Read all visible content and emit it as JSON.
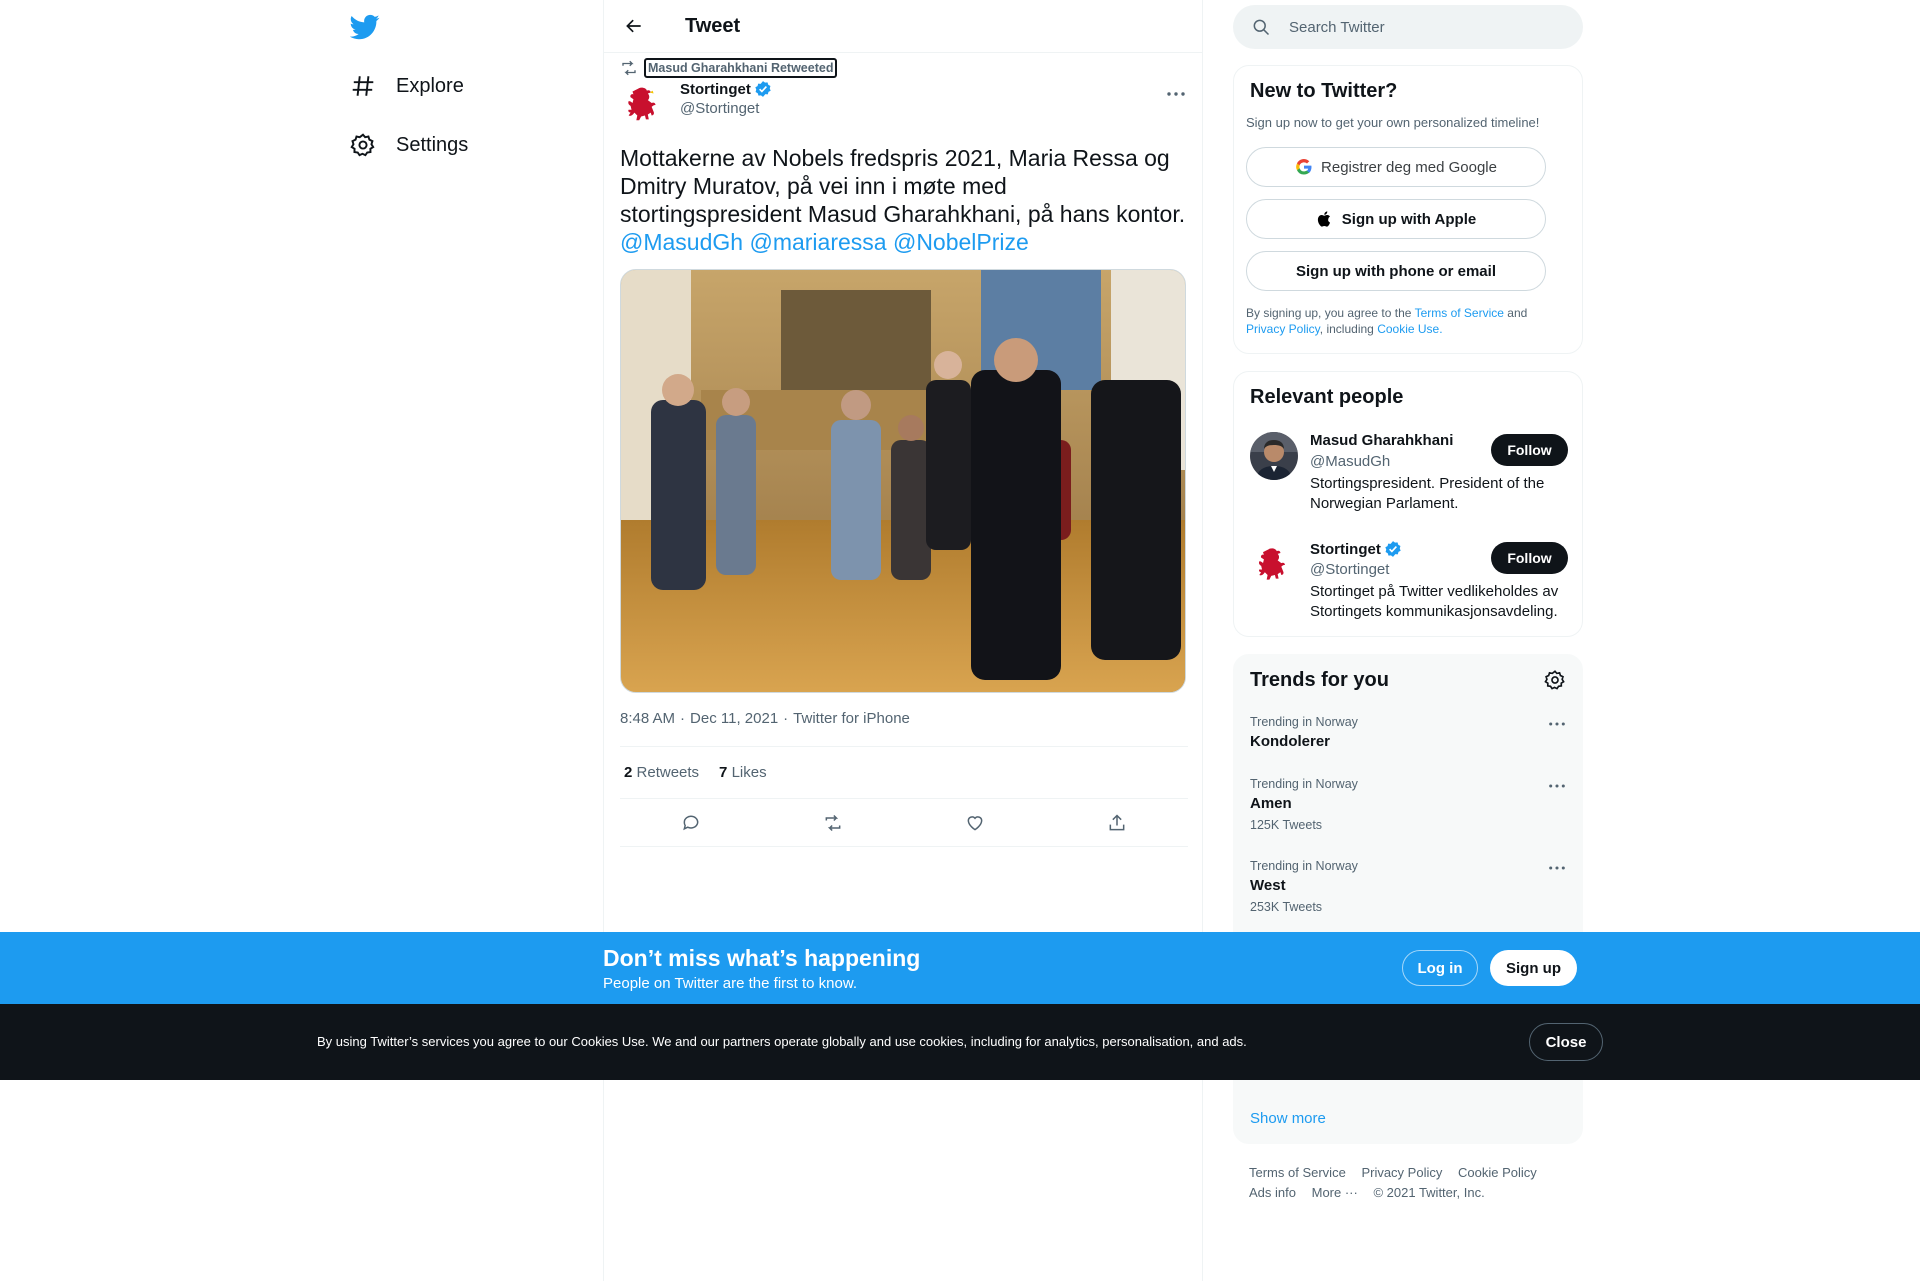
{
  "nav": {
    "items": [
      {
        "label": "Explore",
        "icon": "hashtag-icon"
      },
      {
        "label": "Settings",
        "icon": "gear-icon"
      }
    ]
  },
  "header": {
    "title": "Tweet"
  },
  "tweet": {
    "social_context": "Masud Gharahkhani Retweeted",
    "author_name": "Stortinget",
    "author_handle": "@Stortinget",
    "text_main": "Mottakerne av Nobels fredspris 2021, Maria Ressa og Dmitry Muratov, på vei inn i møte med stortingspresident Masud Gharahkhani, på hans kontor.",
    "mentions": [
      "@MasudGh",
      "@mariaressa",
      "@NobelPrize"
    ],
    "time": "8:48 AM",
    "date": "Dec 11, 2021",
    "source": "Twitter for iPhone",
    "retweets_count": "2",
    "retweets_label": "Retweets",
    "likes_count": "7",
    "likes_label": "Likes"
  },
  "search": {
    "placeholder": "Search Twitter"
  },
  "new_to_twitter": {
    "title": "New to Twitter?",
    "subtitle": "Sign up now to get your own personalized timeline!",
    "google_btn": "Registrer deg med Google",
    "apple_btn": "Sign up with Apple",
    "phone_btn": "Sign up with phone or email",
    "legal_1": "By signing up, you agree to the",
    "terms": "Terms of Service",
    "legal_2": "and",
    "privacy": "Privacy Policy",
    "legal_3": ", including",
    "cookie": "Cookie Use."
  },
  "relevant_people": {
    "title": "Relevant people",
    "people": [
      {
        "name": "Masud Gharahkhani",
        "handle": "@MasudGh",
        "bio": "Stortingspresident. President of the Norwegian Parlament.",
        "follow": "Follow"
      },
      {
        "name": "Stortinget",
        "handle": "@Stortinget",
        "bio": "Stortinget på Twitter vedlikeholdes av Stortingets kommunikasjonsavdeling.",
        "follow": "Follow"
      }
    ]
  },
  "trends": {
    "title": "Trends for you",
    "items": [
      {
        "context": "Trending in Norway",
        "name": "Kondolerer",
        "count": ""
      },
      {
        "context": "Trending in Norway",
        "name": "Amen",
        "count": "125K Tweets"
      },
      {
        "context": "Trending in Norway",
        "name": "West",
        "count": "253K Tweets"
      }
    ],
    "show_more": "Show more"
  },
  "footer": {
    "links": [
      "Terms of Service",
      "Privacy Policy",
      "Cookie Policy",
      "Ads info",
      "More ···",
      "© 2021 Twitter, Inc."
    ]
  },
  "banner": {
    "title": "Don’t miss what’s happening",
    "subtitle": "People on Twitter are the first to know.",
    "login": "Log in",
    "signup": "Sign up"
  },
  "cookie_bar": {
    "text": "By using Twitter’s services you agree to our Cookies Use. We and our partners operate globally and use cookies, including for analytics, personalisation, and ads.",
    "close": "Close"
  },
  "colors": {
    "accent": "#1d9bf0",
    "text": "#0f1419",
    "muted": "#536471",
    "border": "#eff3f4",
    "dark": "#0f1419"
  }
}
